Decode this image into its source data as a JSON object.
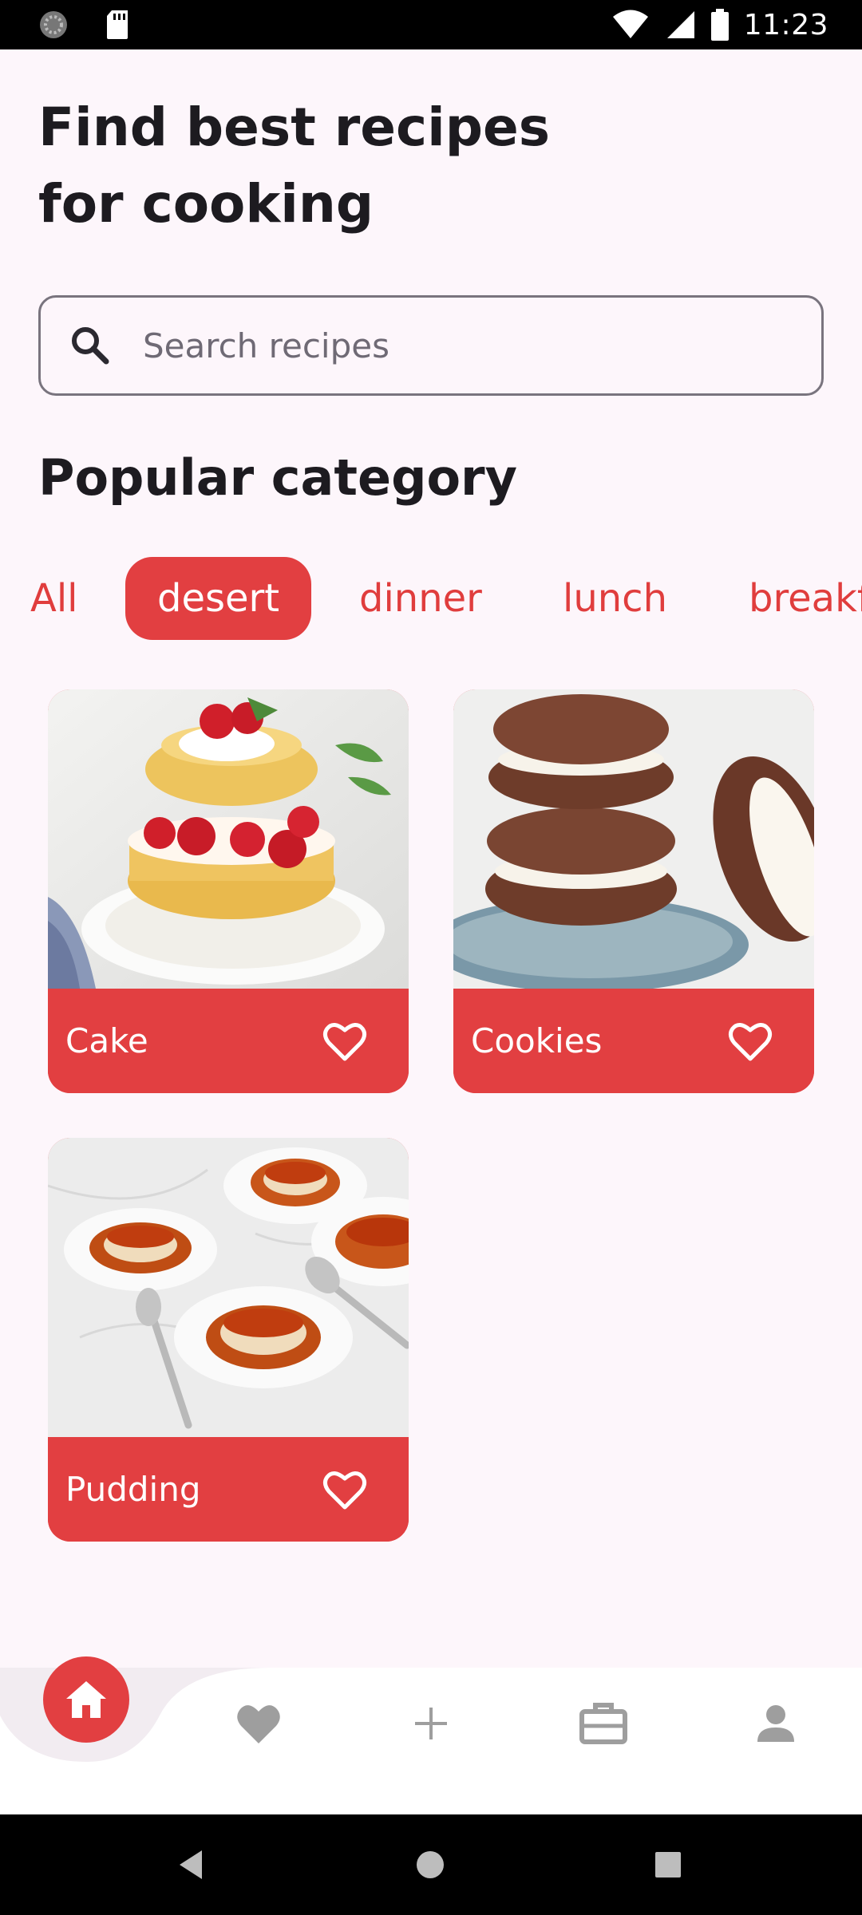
{
  "status_bar": {
    "time": "11:23"
  },
  "header": {
    "line1": "Find best recipes",
    "line2": "for cooking"
  },
  "search": {
    "placeholder": "Search recipes",
    "value": ""
  },
  "popular": {
    "title": "Popular category",
    "categories": [
      "All",
      "desert",
      "dinner",
      "lunch",
      "breakfast"
    ],
    "selected": "desert"
  },
  "recipes": [
    {
      "title": "Cake"
    },
    {
      "title": "Cookies"
    },
    {
      "title": "Pudding"
    }
  ],
  "nav": {
    "items": [
      "home-icon",
      "heart-icon",
      "plus-icon",
      "briefcase-icon",
      "person-icon"
    ],
    "active": "home-icon"
  },
  "colors": {
    "accent": "#e23f41",
    "background": "#fdf6fb",
    "text": "#1d1b20",
    "nav_icon": "#9e9e9e"
  }
}
